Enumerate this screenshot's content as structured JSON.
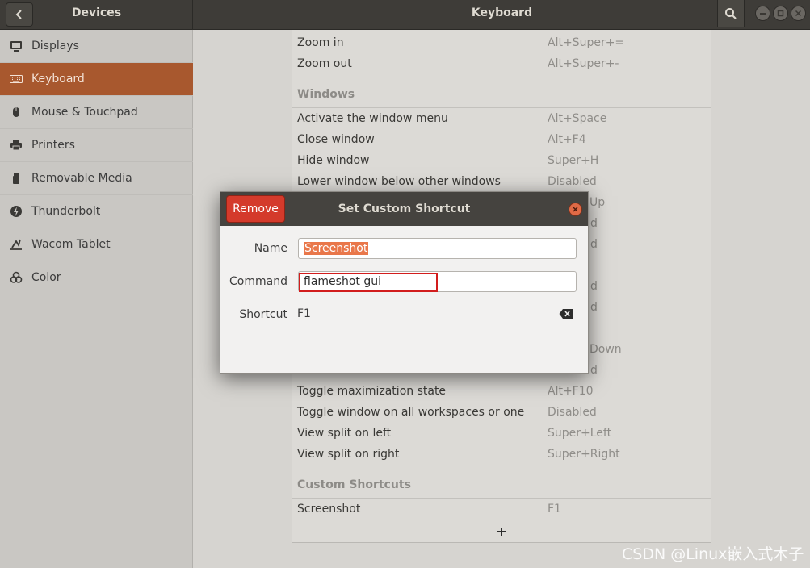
{
  "header": {
    "left_title": "Devices",
    "title": "Keyboard"
  },
  "sidebar": {
    "items": [
      {
        "label": "Displays",
        "icon": "display-icon"
      },
      {
        "label": "Keyboard",
        "icon": "keyboard-icon",
        "selected": true
      },
      {
        "label": "Mouse & Touchpad",
        "icon": "mouse-icon"
      },
      {
        "label": "Printers",
        "icon": "printer-icon"
      },
      {
        "label": "Removable Media",
        "icon": "removable-media-icon"
      },
      {
        "label": "Thunderbolt",
        "icon": "thunderbolt-icon"
      },
      {
        "label": "Wacom Tablet",
        "icon": "tablet-icon"
      },
      {
        "label": "Color",
        "icon": "color-icon"
      }
    ]
  },
  "shortcuts": {
    "top_rows": [
      {
        "name": "Zoom in",
        "key": "Alt+Super+="
      },
      {
        "name": "Zoom out",
        "key": "Alt+Super+-"
      }
    ],
    "windows_section": "Windows",
    "windows_rows": [
      {
        "name": "Activate the window menu",
        "key": "Alt+Space"
      },
      {
        "name": "Close window",
        "key": "Alt+F4"
      },
      {
        "name": "Hide window",
        "key": "Super+H"
      },
      {
        "name": "Lower window below other windows",
        "key": "Disabled"
      }
    ],
    "partial_keys": [
      "Up",
      "d",
      "d",
      "d",
      "d",
      "Down",
      "d"
    ],
    "bottom_rows": [
      {
        "name": "Toggle maximization state",
        "key": "Alt+F10"
      },
      {
        "name": "Toggle window on all workspaces or one",
        "key": "Disabled"
      },
      {
        "name": "View split on left",
        "key": "Super+Left"
      },
      {
        "name": "View split on right",
        "key": "Super+Right"
      }
    ],
    "custom_section": "Custom Shortcuts",
    "custom_rows": [
      {
        "name": "Screenshot",
        "key": "F1"
      }
    ]
  },
  "dialog": {
    "title": "Set Custom Shortcut",
    "remove_label": "Remove",
    "name_label": "Name",
    "name_value": "Screenshot",
    "command_label": "Command",
    "command_value": "flameshot gui",
    "shortcut_label": "Shortcut",
    "shortcut_value": "F1"
  },
  "watermark": "CSDN @Linux嵌入式木子",
  "colors": {
    "accent": "#a8582e",
    "remove_button": "#d43a2b",
    "selection": "#e9774a",
    "highlight_box": "#d21d1d"
  }
}
